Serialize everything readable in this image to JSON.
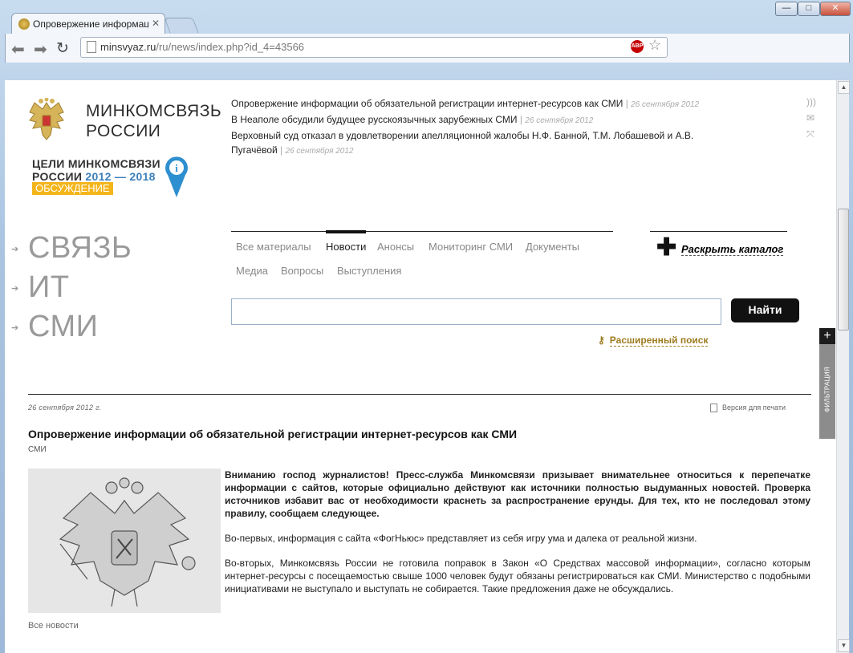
{
  "browser": {
    "tab_title": "Опровержение информации",
    "url_domain": "minsvyaz.ru",
    "url_path": "/ru/news/index.php?id_4=43566",
    "adblock_label": "ABP",
    "window_controls": {
      "minimize": "—",
      "maximize": "□",
      "close": "✕"
    }
  },
  "header": {
    "ministry_line1": "МИНКОМСВЯЗЬ",
    "ministry_line2": "РОССИИ",
    "goals_line1": "ЦЕЛИ МИНКОМСВЯЗИ",
    "goals_line2_prefix": "РОССИИ ",
    "goals_years": "2012 — 2018",
    "goals_badge": "ОБСУЖДЕНИЕ",
    "info_pin": "i",
    "headlines": [
      {
        "text": "Опровержение информации об обязательной регистрации интернет-ресурсов как СМИ",
        "date": "26 сентября 2012"
      },
      {
        "text": "В Неаполе обсудили будущее русскоязычных зарубежных СМИ",
        "date": "26 сентября 2012"
      },
      {
        "text": "Верховный суд отказал в удовлетворении апелляционной жалобы Н.Ф. Банной, Т.М. Лобашевой и А.В. Пугачёвой",
        "date": "26 сентября 2012"
      }
    ],
    "icons": {
      "rss": "rss-icon",
      "mail": "mail-icon",
      "expand": "expand-icon"
    }
  },
  "sections": [
    {
      "label": "СВЯЗЬ"
    },
    {
      "label": "ИТ"
    },
    {
      "label": "СМИ"
    }
  ],
  "material_tabs": [
    {
      "label": "Все материалы"
    },
    {
      "label": "Новости",
      "active": true
    },
    {
      "label": "Анонсы"
    },
    {
      "label": "Мониторинг СМИ"
    },
    {
      "label": "Документы"
    },
    {
      "label": "Медиа"
    },
    {
      "label": "Вопросы"
    },
    {
      "label": "Выступления"
    }
  ],
  "catalog": {
    "label": "Раскрыть каталог"
  },
  "search": {
    "value": "",
    "button": "Найти",
    "advanced": "Расширенный поиск"
  },
  "filter": {
    "label": "ФИЛЬТРАЦИЯ",
    "plus": "+"
  },
  "article": {
    "date": "26 сентября 2012 г.",
    "print_label": "Версия для печати",
    "title": "Опровержение информации об обязательной регистрации интернет-ресурсов как СМИ",
    "category": "СМИ",
    "paragraphs": [
      "Вниманию господ журналистов! Пресс-служба Минкомсвязи призывает внимательнее относиться к перепечатке информации с сайтов, которые официально действуют как источники полностью выдуманных новостей. Проверка источников избавит вас от необходимости краснеть за распространение ерунды. Для тех, кто не последовал этому правилу, сообщаем следующее.",
      "Во-первых, информация с сайта «ФогНьюс» представляет из себя игру ума и далека от реальной жизни.",
      "Во-вторых, Минкомсвязь России не готовила поправок в Закон «О Средствах массовой информации», согласно которым интернет-ресурсы с посещаемостью свыше 1000 человек будут обязаны регистрироваться как СМИ. Министерство с подобными инициативами не выступало и выступать не собирается. Такие предложения даже не обсуждались."
    ],
    "all_news": "Все новости"
  },
  "colors": {
    "accent_yellow": "#f4b51b",
    "pin_blue": "#2e8fd0",
    "link_gold": "#9c7b1f"
  }
}
